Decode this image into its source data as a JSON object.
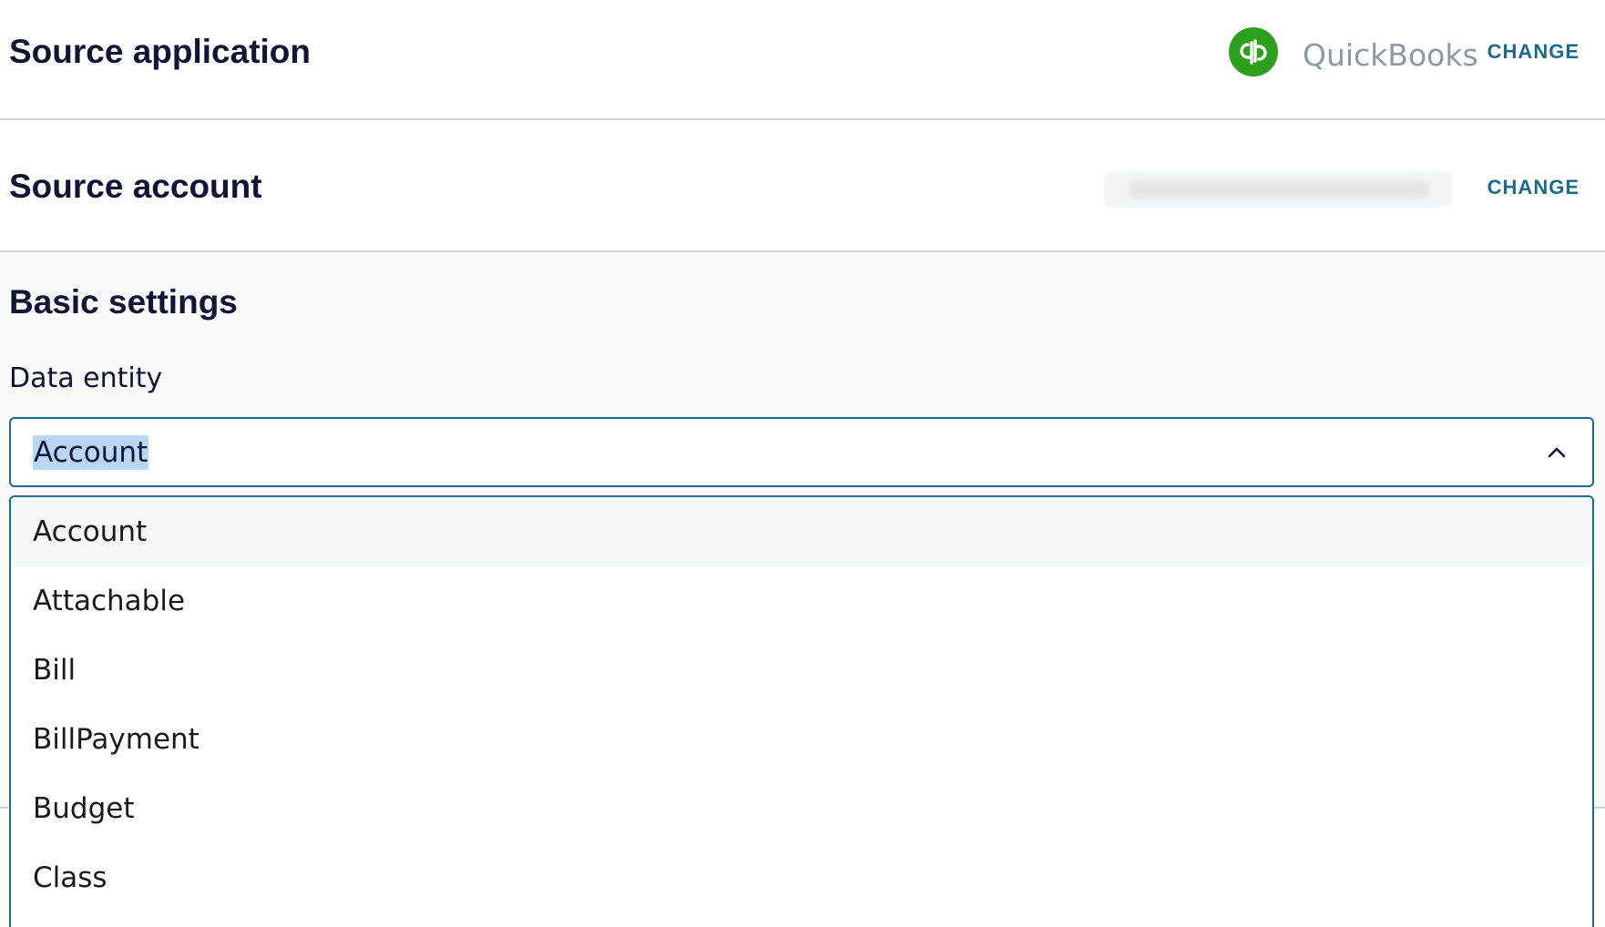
{
  "source_application": {
    "title": "Source application",
    "app_name": "QuickBooks",
    "change_label": "CHANGE",
    "logo_icon": "quickbooks-logo-icon",
    "logo_color": "#2ca01c"
  },
  "source_account": {
    "title": "Source account",
    "change_label": "CHANGE"
  },
  "basic_settings": {
    "title": "Basic settings",
    "data_entity": {
      "label": "Data entity",
      "selected": "Account",
      "options": [
        "Account",
        "Attachable",
        "Bill",
        "BillPayment",
        "Budget",
        "Class"
      ]
    }
  },
  "colors": {
    "accent": "#1a6b8f",
    "heading": "#0f1535",
    "selection_highlight": "#b9d6f5"
  }
}
